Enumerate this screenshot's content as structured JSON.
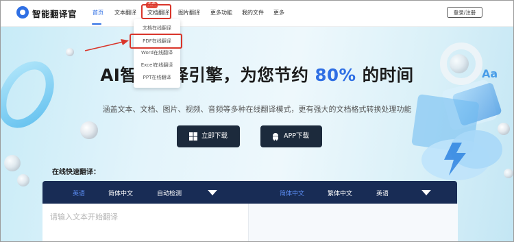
{
  "header": {
    "brand": "智能翻译官",
    "nav": [
      "首页",
      "文本翻译",
      "文档翻译",
      "图片翻译",
      "更多功能",
      "我的文件",
      "更多"
    ],
    "badge": "免费",
    "login": "登录/注册"
  },
  "dropdown": {
    "items": [
      "文档在线翻译",
      "PDF在线翻译",
      "Word在线翻译",
      "Excel在线翻译",
      "PPT在线翻译"
    ]
  },
  "hero": {
    "title_prefix": "AI智能翻译引擎，为您节约 ",
    "title_pct": "80%",
    "title_suffix": " 的时间",
    "subtitle": "涵盖文本、文档、图片、视频、音频等多种在线翻译模式，更有强大的文档格式转换处理功能",
    "download_label": "立即下载",
    "app_label": "APP下载"
  },
  "translator": {
    "heading": "在线快速翻译：",
    "source_langs": [
      "英语",
      "简体中文",
      "自动检测"
    ],
    "target_langs": [
      "简体中文",
      "繁体中文",
      "英语"
    ],
    "placeholder": "请输入文本开始翻译"
  },
  "colors": {
    "accent": "#2f6fe4",
    "dark_button": "#1c2a3c",
    "lang_bar": "#182c55",
    "annotation": "#d9352a"
  }
}
